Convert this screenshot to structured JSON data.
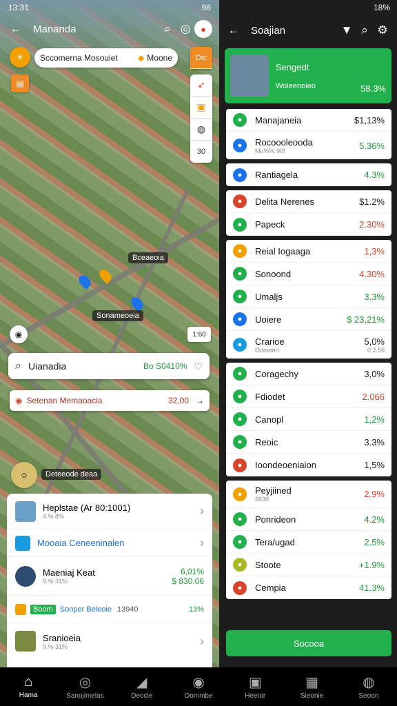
{
  "left": {
    "status_time": "13:31",
    "status_right": "96",
    "title": "Mananda",
    "chip_location": "Sccomerna Mosouiet",
    "chip_tag": "Moone",
    "side_action_label": "Dic",
    "side_zoom": "30",
    "map_label_1": "Bceaeoia",
    "map_label_2": "Sonameoeia",
    "map_scale": "1:60",
    "search_text": "Uianadia",
    "search_value": "Bo S0410%",
    "bar2_text": "Setenan Memaoacia",
    "bar2_value": "32,00",
    "avatar_label": "Deteeode deaa",
    "sheet": [
      {
        "title": "Heplstae (Ar 80:1001)",
        "sub": "4.% 8%"
      },
      {
        "title": "Mooaia Ceneeninalen",
        "sub": ""
      },
      {
        "title": "Maeniaj Keat",
        "sub": "9.% 31%",
        "value": "6,01%",
        "value2": "$ 830.06"
      },
      {
        "title": "Sonper Beleoie",
        "tag": "Boom",
        "value": "13%",
        "mid": "13940"
      },
      {
        "title": "Sranioeia",
        "sub": "9.% 31%"
      }
    ]
  },
  "right": {
    "status_right": "18%",
    "title": "Soajian",
    "hero_title": "Sengedt",
    "hero_sub": "Woleenoieo",
    "hero_value": "58.3%",
    "groups": [
      [
        {
          "label": "Manajaneia",
          "value": "$1,13%",
          "color": "dark",
          "icon": "#21b04b"
        },
        {
          "label": "Rocoooleooda",
          "sub": "Mu%% 90f",
          "value": "5.36%",
          "color": "green",
          "icon": "#1a73e8"
        }
      ],
      [
        {
          "label": "Rantiagela",
          "value": "4.3%",
          "color": "green",
          "icon": "#1a73e8"
        }
      ],
      [
        {
          "label": "Delita Nerenes",
          "value": "$1.2%",
          "color": "dark",
          "icon": "#d9452b"
        },
        {
          "label": "Papeck",
          "value": "2.30%",
          "color": "red",
          "icon": "#21b04b"
        }
      ],
      [
        {
          "label": "Reial Iogaaga",
          "value": "1,3%",
          "color": "red",
          "icon": "#f2a000"
        },
        {
          "label": "Sonoond",
          "value": "4.30%",
          "color": "red",
          "icon": "#21b04b"
        },
        {
          "label": "Umaljs",
          "value": "3.3%",
          "color": "green",
          "icon": "#21b04b"
        },
        {
          "label": "Uoiere",
          "value": "$ 23,21%",
          "color": "green",
          "icon": "#1a73e8"
        },
        {
          "label": "Crarioe",
          "sub": "Oonoton",
          "value": "5,0%",
          "value2": "0 2.56",
          "color": "dark",
          "icon": "#1a9be0"
        }
      ],
      [
        {
          "label": "Coragechy",
          "value": "3,0%",
          "color": "dark",
          "icon": "#21b04b"
        },
        {
          "label": "Fdiodet",
          "value": "2.066",
          "color": "red",
          "icon": "#21b04b"
        },
        {
          "label": "Canopl",
          "value": "1,2%",
          "color": "green",
          "icon": "#21b04b"
        },
        {
          "label": "Reoic",
          "value": "3.3%",
          "color": "dark",
          "icon": "#21b04b"
        },
        {
          "label": "Ioondeoeniaion",
          "value": "1,5%",
          "color": "dark",
          "icon": "#d9452b"
        }
      ],
      [
        {
          "label": "Peyjiined",
          "sub": "2636",
          "value": "2.9%",
          "color": "red",
          "icon": "#f2a000"
        },
        {
          "label": "Ponrideon",
          "value": "4.2%",
          "color": "green",
          "icon": "#21b04b"
        },
        {
          "label": "Tera/ugad",
          "value": "2.5%",
          "color": "green",
          "icon": "#21b04b"
        },
        {
          "label": "Stoote",
          "value": "+1.9%",
          "color": "green",
          "icon": "#a8b820"
        },
        {
          "label": "Cempia",
          "value": "41.3%",
          "color": "green",
          "icon": "#d9452b"
        }
      ]
    ],
    "cta_label": "Socooa"
  },
  "nav": [
    {
      "label": "Hama",
      "glyph": "⌂",
      "active": true
    },
    {
      "label": "Sanojimelas",
      "glyph": "◎"
    },
    {
      "label": "Deocie",
      "glyph": "◢"
    },
    {
      "label": "Oommbe",
      "glyph": "◉"
    },
    {
      "label": "Heetor",
      "glyph": "▣"
    },
    {
      "label": "Sieonie",
      "glyph": "▦"
    },
    {
      "label": "Seoon",
      "glyph": "◍"
    }
  ]
}
